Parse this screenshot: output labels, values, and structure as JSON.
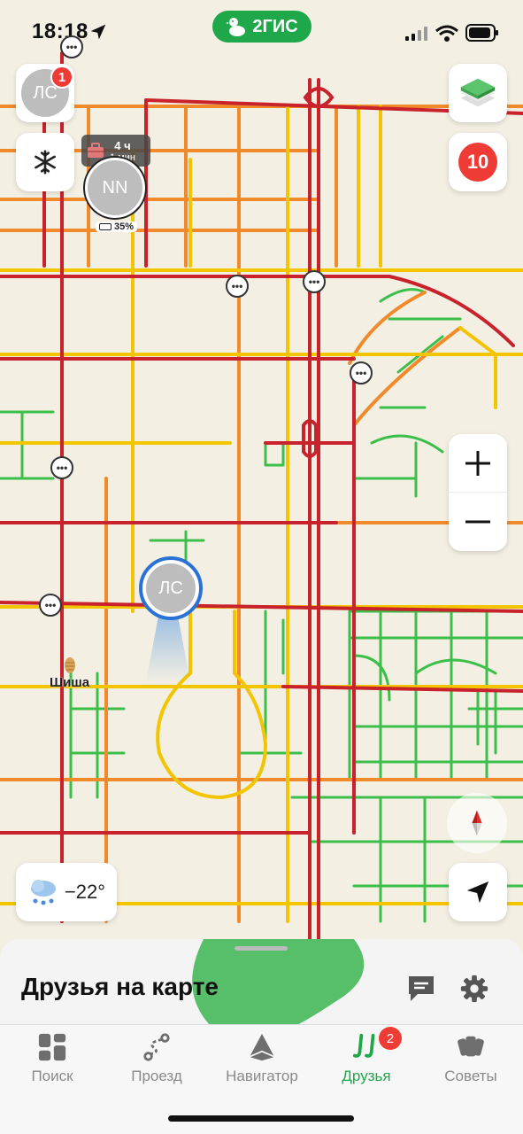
{
  "status_bar": {
    "time": "18:18",
    "app_brand": "2ГИС"
  },
  "me": {
    "initials": "ЛС",
    "notifications": "1"
  },
  "friend": {
    "initials": "NN",
    "duration": "4 ч",
    "update_ago": "1 мин",
    "battery": "35%"
  },
  "traffic_score": "10",
  "weather": {
    "temperature": "−22°",
    "icon": "snow-cloud-icon"
  },
  "map_labels": {
    "poi": "Шиша"
  },
  "sheet": {
    "title": "Друзья на карте"
  },
  "tabs": [
    {
      "label": "Поиск",
      "icon": "grid-icon"
    },
    {
      "label": "Проезд",
      "icon": "route-icon"
    },
    {
      "label": "Навигатор",
      "icon": "navigator-icon"
    },
    {
      "label": "Друзья",
      "icon": "friends-icon",
      "badge": "2",
      "active": true
    },
    {
      "label": "Советы",
      "icon": "cards-icon"
    }
  ],
  "colors": {
    "accent": "#1fa84a",
    "badge": "#ee3b35",
    "traffic_red": "#c8232c",
    "traffic_yellow": "#f2c500",
    "traffic_green": "#3cbf4a",
    "traffic_orange": "#f08a2a"
  }
}
